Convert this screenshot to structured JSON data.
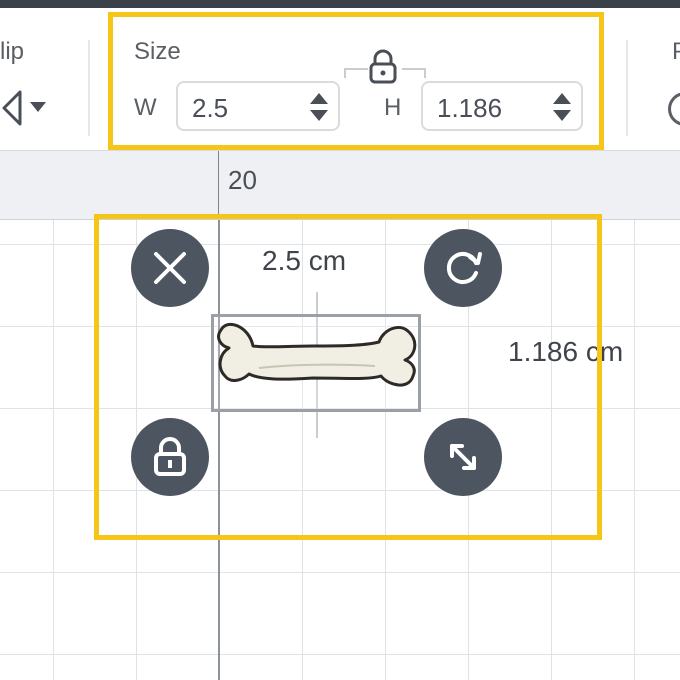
{
  "toolbar": {
    "flip_label": "lip",
    "size_label": "Size",
    "width_label": "W",
    "width_value": "2.5",
    "height_label": "H",
    "height_value": "1.186",
    "right_cut_label": "P"
  },
  "ruler": {
    "tick_label": "20"
  },
  "selection": {
    "width_dim": "2.5 cm",
    "height_dim": "1.186 cm"
  },
  "icons": [
    "flip-icon",
    "lock-icon",
    "stepper-icon",
    "close-icon",
    "rotate-icon",
    "lock-icon",
    "scale-icon",
    "bone-shape"
  ],
  "colors": {
    "highlight": "#f5c518",
    "handle": "#4d5660",
    "bone_fill": "#f1efe3",
    "canvas_grid": "#dfe3e8"
  }
}
